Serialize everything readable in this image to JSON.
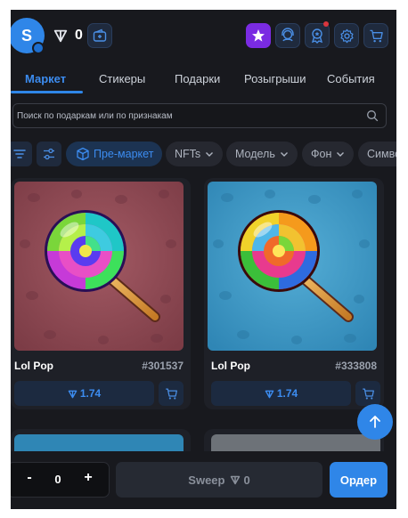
{
  "header": {
    "avatar_letter": "S",
    "balance": "0"
  },
  "tabs": [
    {
      "label": "Маркет",
      "active": true
    },
    {
      "label": "Стикеры",
      "active": false
    },
    {
      "label": "Подарки",
      "active": false
    },
    {
      "label": "Розыгрыши",
      "active": false
    },
    {
      "label": "События",
      "active": false
    }
  ],
  "search": {
    "placeholder": "Поиск по подаркам или по признакам"
  },
  "filters": {
    "premarket": "Пре-маркет",
    "chips": [
      "NFTs",
      "Модель",
      "Фон",
      "Симво"
    ]
  },
  "items": [
    {
      "title": "Lol Pop",
      "number": "#301537",
      "price": "1.74",
      "background": "#8a4550"
    },
    {
      "title": "Lol Pop",
      "number": "#333808",
      "price": "1.74",
      "background": "#3f98c4"
    }
  ],
  "bottom": {
    "minus": "-",
    "quantity": "0",
    "plus": "+",
    "sweep_label": "Sweep",
    "sweep_value": "0",
    "order_label": "Ордер"
  },
  "colors": {
    "accent": "#2f86e8",
    "background": "#18191e",
    "star_button": "#7a2be2"
  }
}
